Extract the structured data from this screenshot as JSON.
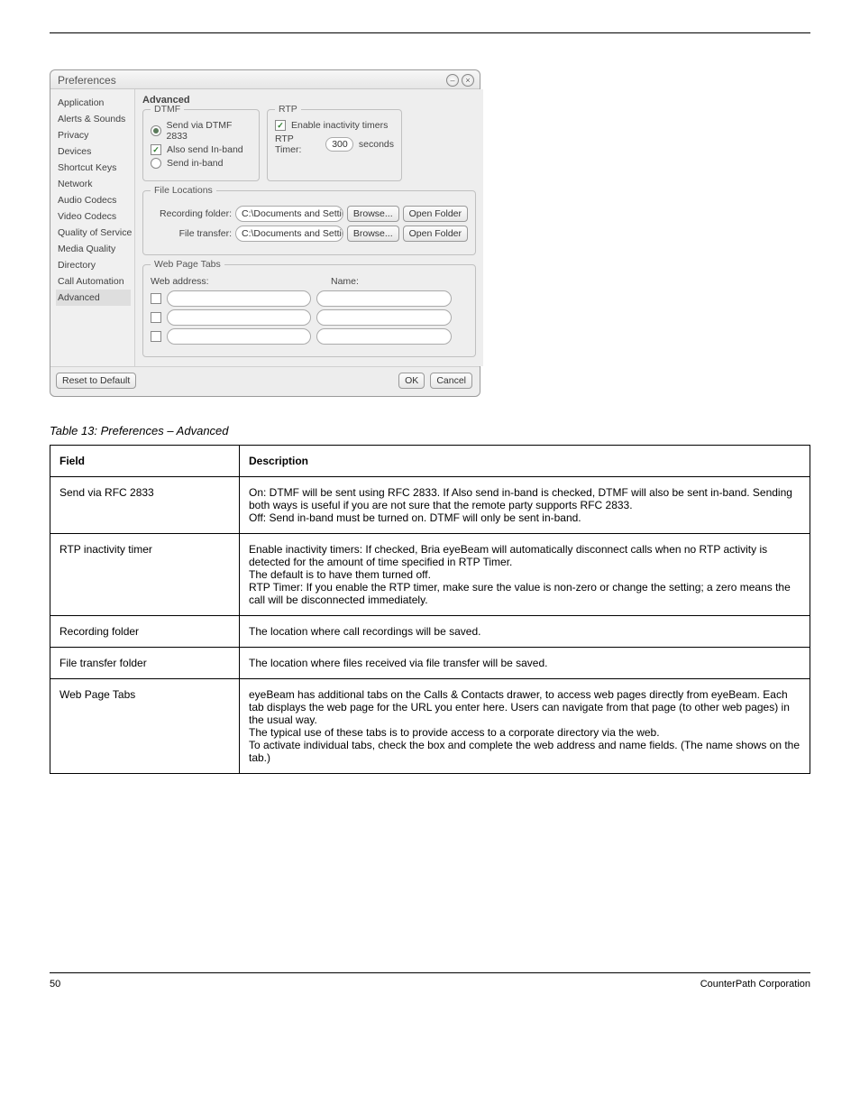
{
  "header": {
    "right": "",
    "left": ""
  },
  "dialog": {
    "title": "Preferences",
    "sidebar": {
      "items": [
        "Application",
        "Alerts & Sounds",
        "Privacy",
        "Devices",
        "Shortcut Keys",
        "Network",
        "Audio Codecs",
        "Video Codecs",
        "Quality of Service",
        "Media Quality",
        "Directory",
        "Call Automation",
        "Advanced"
      ],
      "selected_index": 12
    },
    "main": {
      "title": "Advanced",
      "dtmf": {
        "legend": "DTMF",
        "opt1": "Send via DTMF 2833",
        "opt2": "Also send In-band",
        "opt3": "Send in-band"
      },
      "rtp": {
        "legend": "RTP",
        "enable": "Enable inactivity timers",
        "timer_label": "RTP Timer:",
        "timer_value": "300",
        "timer_unit": "seconds"
      },
      "files": {
        "legend": "File Locations",
        "recording_label": "Recording folder:",
        "recording_value": "C:\\Documents and Settings\\c' ɹ '\\My",
        "transfer_label": "File transfer:",
        "transfer_value": "C:\\Documents and Settings\\c ɹ '\\D<",
        "browse": "Browse...",
        "open": "Open Folder"
      },
      "webtabs": {
        "legend": "Web Page Tabs",
        "addr_hdr": "Web address:",
        "name_hdr": "Name:"
      }
    },
    "footer": {
      "reset": "Reset to Default",
      "ok": "OK",
      "cancel": "Cancel"
    }
  },
  "table": {
    "caption": "Table 13: Preferences – Advanced",
    "h1": "Field",
    "h2": "Description",
    "rows": [
      {
        "f": "Send via RFC 2833",
        "d": "On: DTMF will be sent using RFC 2833. If Also send in-band is checked, DTMF will also be sent in-band. Sending both ways is useful if you are not sure that the remote party supports RFC 2833.\nOff: Send in-band must be turned on. DTMF will only be sent in-band."
      },
      {
        "f": "RTP inactivity timer",
        "d": "Enable inactivity timers: If checked, Bria eyeBeam will automatically disconnect calls when no RTP activity is detected for the amount of time specified in RTP Timer.\nThe default is to have them turned off.\nRTP Timer: If you enable the RTP timer, make sure the value is non-zero or change the setting; a zero means the call will be disconnected immediately."
      },
      {
        "f": "Recording folder",
        "d": "The location where call recordings will be saved."
      },
      {
        "f": "File transfer folder",
        "d": "The location where files received via file transfer will be saved."
      },
      {
        "f": "Web Page Tabs",
        "d": "eyeBeam has additional tabs on the Calls & Contacts drawer, to access web pages directly from eyeBeam. Each tab displays the web page for the URL you enter here. Users can navigate from that page (to other web pages) in the usual way.\nThe typical use of these tabs is to provide access to a corporate directory via the web.\nTo activate individual tabs, check the box and complete the web address and name fields. (The name shows on the tab.)"
      }
    ]
  },
  "footer_text": "CounterPath Corporation",
  "page_no": "50"
}
